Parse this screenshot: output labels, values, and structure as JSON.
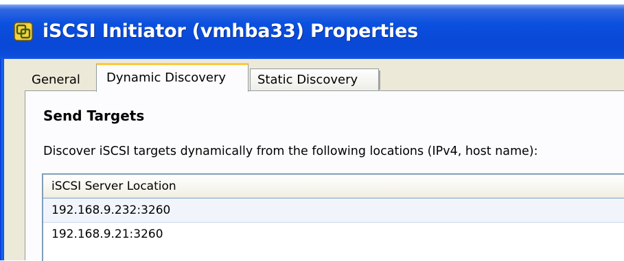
{
  "window": {
    "title": "iSCSI Initiator (vmhba33) Properties",
    "icon": "vmware-icon"
  },
  "tabs": [
    {
      "label": "General",
      "active": false
    },
    {
      "label": "Dynamic Discovery",
      "active": true
    },
    {
      "label": "Static Discovery",
      "active": false
    }
  ],
  "panel": {
    "section_title": "Send Targets",
    "description": "Discover iSCSI targets dynamically from the following locations (IPv4, host name):"
  },
  "table": {
    "column_header": "iSCSI Server Location",
    "rows": [
      "192.168.9.232:3260",
      "192.168.9.21:3260"
    ],
    "selected_index": 0
  },
  "colors": {
    "titlebar": "#0b50df",
    "active_tab_accent": "#ffc83c",
    "dialog_bg": "#ece9d8"
  }
}
